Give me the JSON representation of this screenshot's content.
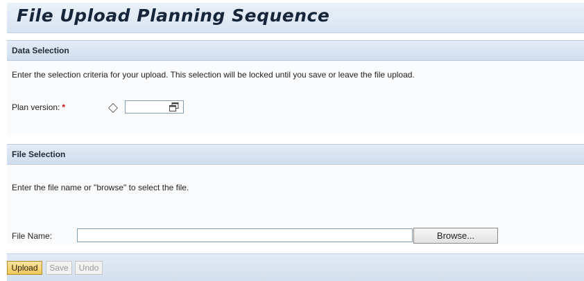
{
  "header": {
    "title": "File Upload Planning Sequence"
  },
  "data_selection": {
    "title": "Data Selection",
    "description": "Enter the selection criteria for your upload. This selection will be locked until you save or leave the file upload.",
    "plan_version_label": "Plan version:",
    "required_marker": "*",
    "plan_version_value": ""
  },
  "file_selection": {
    "title": "File Selection",
    "description": "Enter the file name or \"browse\" to select the file.",
    "file_name_label": "File Name:",
    "file_name_value": "",
    "browse_label": "Browse..."
  },
  "toolbar": {
    "upload_label": "Upload",
    "save_label": "Save",
    "undo_label": "Undo"
  },
  "colors": {
    "header_background": "#d7e3f1",
    "upload_button": "#efc75a",
    "required_star": "#cc1111",
    "disabled_text": "#9a9a9a"
  },
  "icons": {
    "required_indicator": "diamond-icon",
    "value_help": "value-help-icon"
  }
}
